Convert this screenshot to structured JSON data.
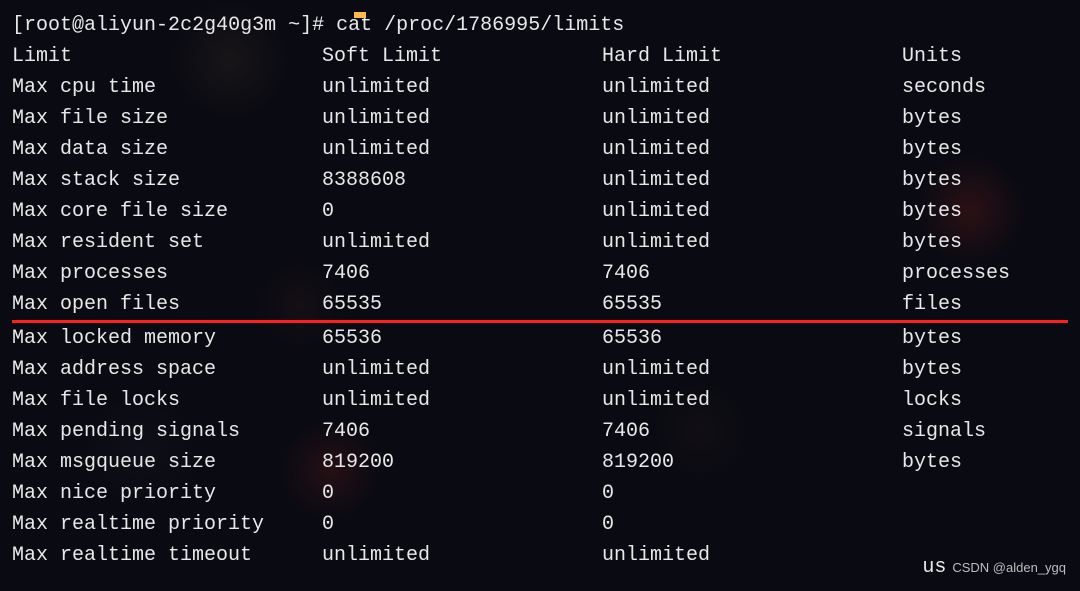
{
  "prompt": {
    "user": "root",
    "host": "aliyun-2c2g40g3m",
    "cwd": "~",
    "symbol": "#",
    "command": "cat /proc/1786995/limits"
  },
  "headers": {
    "limit": "Limit",
    "soft": "Soft Limit",
    "hard": "Hard Limit",
    "units": "Units"
  },
  "rows": [
    {
      "limit": "Max cpu time",
      "soft": "unlimited",
      "hard": "unlimited",
      "units": "seconds",
      "hl": false
    },
    {
      "limit": "Max file size",
      "soft": "unlimited",
      "hard": "unlimited",
      "units": "bytes",
      "hl": false
    },
    {
      "limit": "Max data size",
      "soft": "unlimited",
      "hard": "unlimited",
      "units": "bytes",
      "hl": false
    },
    {
      "limit": "Max stack size",
      "soft": "8388608",
      "hard": "unlimited",
      "units": "bytes",
      "hl": false
    },
    {
      "limit": "Max core file size",
      "soft": "0",
      "hard": "unlimited",
      "units": "bytes",
      "hl": false
    },
    {
      "limit": "Max resident set",
      "soft": "unlimited",
      "hard": "unlimited",
      "units": "bytes",
      "hl": false
    },
    {
      "limit": "Max processes",
      "soft": "7406",
      "hard": "7406",
      "units": "processes",
      "hl": false
    },
    {
      "limit": "Max open files",
      "soft": "65535",
      "hard": "65535",
      "units": "files",
      "hl": true
    },
    {
      "limit": "Max locked memory",
      "soft": "65536",
      "hard": "65536",
      "units": "bytes",
      "hl": false
    },
    {
      "limit": "Max address space",
      "soft": "unlimited",
      "hard": "unlimited",
      "units": "bytes",
      "hl": false
    },
    {
      "limit": "Max file locks",
      "soft": "unlimited",
      "hard": "unlimited",
      "units": "locks",
      "hl": false
    },
    {
      "limit": "Max pending signals",
      "soft": "7406",
      "hard": "7406",
      "units": "signals",
      "hl": false
    },
    {
      "limit": "Max msgqueue size",
      "soft": "819200",
      "hard": "819200",
      "units": "bytes",
      "hl": false
    },
    {
      "limit": "Max nice priority",
      "soft": "0",
      "hard": "0",
      "units": "",
      "hl": false
    },
    {
      "limit": "Max realtime priority",
      "soft": "0",
      "hard": "0",
      "units": "",
      "hl": false
    },
    {
      "limit": "Max realtime timeout",
      "soft": "unlimited",
      "hard": "unlimited",
      "units": "us",
      "hl": false
    }
  ],
  "watermark": "CSDN @alden_ygq"
}
